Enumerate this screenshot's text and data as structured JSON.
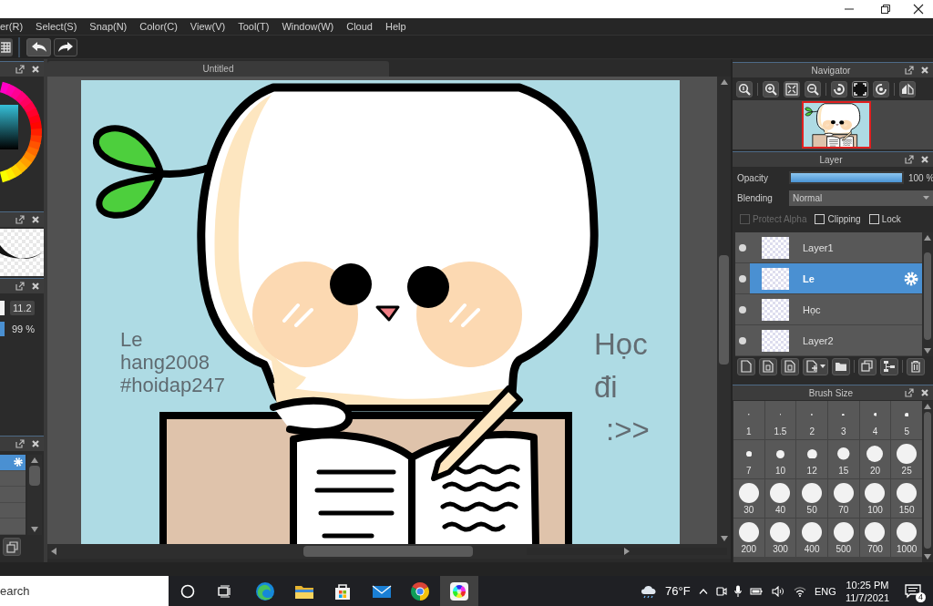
{
  "menu_bar": [
    "er(R)",
    "Select(S)",
    "Snap(N)",
    "Color(C)",
    "View(V)",
    "Tool(T)",
    "Window(W)",
    "Cloud",
    "Help"
  ],
  "left_panels": {
    "size_reading": "11.2",
    "opacity_reading": "99 %",
    "list_rows": [
      {
        "selected": true
      },
      {
        "selected": false
      },
      {
        "selected": false
      },
      {
        "selected": false
      },
      {
        "selected": false
      }
    ]
  },
  "document_tab": {
    "title": "Untitled"
  },
  "canvas": {
    "texts": [
      {
        "kind": "note",
        "lines": [
          "Le",
          "hang2008",
          "#hoidap247"
        ]
      },
      {
        "kind": "shout",
        "lines": [
          "Học",
          "đi",
          ":>>"
        ]
      }
    ]
  },
  "navigator": {
    "title": "Navigator",
    "tools": [
      {
        "kind": "actual-size",
        "on": false
      },
      {
        "kind": "zoom-in",
        "on": false
      },
      {
        "kind": "fit",
        "on": false
      },
      {
        "kind": "zoom-out",
        "on": false
      },
      {
        "kind": "rotate-left",
        "on": false
      },
      {
        "kind": "frame",
        "on": true
      },
      {
        "kind": "rotate-right",
        "on": false
      },
      {
        "kind": "flip",
        "on": false
      }
    ]
  },
  "layer_panel": {
    "title": "Layer",
    "opacity": {
      "label": "Opacity",
      "level": 1,
      "reading": "100 %"
    },
    "blending": {
      "label": "Blending",
      "value": "Normal"
    },
    "options": [
      {
        "label": "Protect Alpha",
        "checked": false,
        "disabled": true
      },
      {
        "label": "Clipping",
        "checked": false,
        "disabled": false
      },
      {
        "label": "Lock",
        "checked": false,
        "disabled": false
      }
    ],
    "layers": [
      {
        "name": "Layer1",
        "visible": true,
        "selected": false
      },
      {
        "name": "Le",
        "visible": true,
        "selected": true
      },
      {
        "name": "Học",
        "visible": true,
        "selected": false
      },
      {
        "name": "Layer2",
        "visible": true,
        "selected": false
      }
    ]
  },
  "brush_size": {
    "title": "Brush Size",
    "sizes": [
      "1",
      "1.5",
      "2",
      "3",
      "4",
      "5",
      "7",
      "10",
      "12",
      "15",
      "20",
      "25",
      "30",
      "40",
      "50",
      "70",
      "100",
      "150",
      "200",
      "300",
      "400",
      "500",
      "700",
      "1000"
    ]
  },
  "taskbar": {
    "search": {
      "placeholder": "earch"
    },
    "apps": [
      {
        "kind": "swirl",
        "selected": false
      },
      {
        "kind": "folder",
        "selected": false
      },
      {
        "kind": "bag",
        "selected": false
      },
      {
        "kind": "mail",
        "selected": false
      },
      {
        "kind": "ring",
        "selected": false
      },
      {
        "kind": "palette",
        "selected": true
      }
    ],
    "weather": "76°F",
    "language": "ENG",
    "time": "10:25 PM",
    "date": "11/7/2021",
    "notifications": "4"
  }
}
